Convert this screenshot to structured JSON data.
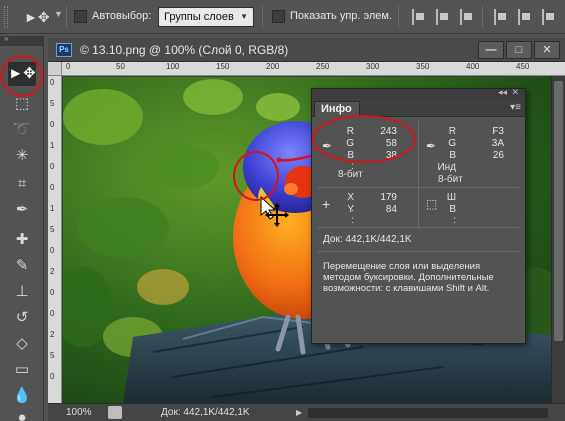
{
  "options_bar": {
    "auto_select_label": "Автовыбор:",
    "auto_select_value": "Группы слоев",
    "show_transform_label": "Показать упр. элем."
  },
  "toolbar": {
    "tools": [
      "move-tool",
      "marquee-tool",
      "lasso-tool",
      "magic-wand-tool",
      "crop-tool",
      "eyedropper-tool",
      "healing-brush-tool",
      "brush-tool",
      "clone-stamp-tool",
      "history-brush-tool",
      "eraser-tool",
      "gradient-tool",
      "blur-tool",
      "dodge-tool"
    ],
    "active_tool": "move-tool"
  },
  "document": {
    "badge": "Ps",
    "title": "© 13.10.png @ 100% (Слой 0, RGB/8)",
    "ruler_top": [
      "0",
      "50",
      "100",
      "150",
      "200",
      "250",
      "300",
      "350",
      "400",
      "450"
    ],
    "ruler_left": [
      "0",
      "5",
      "0",
      "1",
      "0",
      "0",
      "1",
      "5",
      "0",
      "2",
      "0",
      "0",
      "2",
      "5",
      "0"
    ],
    "status_zoom": "100%",
    "status_doc": "Док: 442,1K/442,1K"
  },
  "info_panel": {
    "tab_label": "Инфо",
    "left": {
      "channels": [
        "R :",
        "G :",
        "B :"
      ],
      "values": [
        "243",
        "58",
        "38"
      ],
      "bits": "8-бит"
    },
    "right": {
      "channels": [
        "R :",
        "G :",
        "B :",
        "Инд :"
      ],
      "values": [
        "F3",
        "3A",
        "26",
        ""
      ],
      "bits": "8-бит"
    },
    "coords": {
      "labels": [
        "X :",
        "Y :"
      ],
      "values": [
        "179",
        "84"
      ]
    },
    "size": {
      "labels": [
        "Ш :",
        "В :"
      ],
      "values": [
        "",
        ""
      ]
    },
    "doc_size": "Док: 442,1K/442,1K",
    "help_text": "Перемещение слоя или выделения методом буксировки.  Дополнительные возможности: с клавишами Shift и Alt."
  },
  "colors": {
    "annotation_red": "#d8131b",
    "panel_bg": "#535353",
    "ps_badge": "#1b3a66"
  }
}
